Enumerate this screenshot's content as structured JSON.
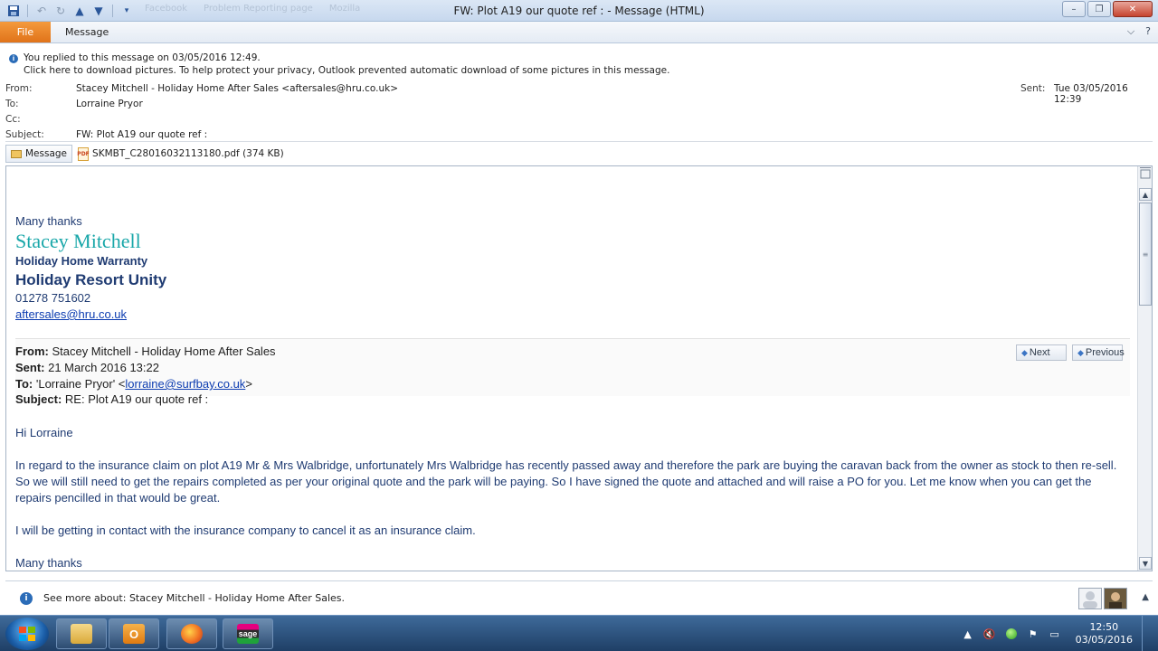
{
  "window": {
    "title": "FW: Plot A19  our quote ref :  - Message (HTML)",
    "ghost_tabs": [
      "Facebook",
      "Problem Reporting page",
      "Mozilla"
    ],
    "minimize": "–",
    "maximize": "❐",
    "close": "✕"
  },
  "ribbon": {
    "file_tab": "File",
    "message_tab": "Message",
    "expand_icon": "⌵",
    "help_icon": "?"
  },
  "infobar": {
    "line1": "You replied to this message on 03/05/2016 12:49.",
    "line2": "Click here to download pictures. To help protect your privacy, Outlook prevented automatic download of some pictures in this message."
  },
  "header": {
    "from_label": "From:",
    "from_value": "Stacey Mitchell - Holiday Home After Sales <aftersales@hru.co.uk>",
    "to_label": "To:",
    "to_value": "Lorraine Pryor",
    "cc_label": "Cc:",
    "cc_value": "",
    "subject_label": "Subject:",
    "subject_value": "FW: Plot A19  our quote ref :",
    "sent_label": "Sent:",
    "sent_value": "Tue 03/05/2016 12:39"
  },
  "attachments": {
    "message_label": "Message",
    "pdf_label": "SKMBT_C28016032113180.pdf (374 KB)"
  },
  "body": {
    "sig_thanks": "Many thanks",
    "sig_name": "Stacey Mitchell",
    "sig_warranty": "Holiday Home Warranty",
    "sig_company": "Holiday Resort Unity",
    "sig_phone": "01278 751602",
    "sig_email": "aftersales@hru.co.uk",
    "fw_from_label": "From:",
    "fw_from_value": " Stacey Mitchell - Holiday Home After Sales",
    "fw_sent_label": "Sent:",
    "fw_sent_value": " 21 March 2016 13:22",
    "fw_to_label": "To:",
    "fw_to_prefix": " 'Lorraine Pryor' <",
    "fw_to_email": "lorraine@surfbay.co.uk",
    "fw_to_suffix": ">",
    "fw_subject_label": "Subject:",
    "fw_subject_value": " RE: Plot A19 our quote ref :",
    "next_label": "Next",
    "previous_label": "Previous",
    "greeting": "Hi Lorraine",
    "para1": "In regard to the insurance claim on plot A19 Mr & Mrs Walbridge, unfortunately Mrs Walbridge has recently passed away and therefore the park are buying the caravan back from the owner as stock to then re-sell. So we will still need to get the repairs completed as per your original quote and the park will be paying. So I have signed the quote and attached and will raise a PO for you. Let me know when you can get the repairs pencilled in that would be great.",
    "para2": "I will be getting in contact with the insurance company to cancel it as an insurance claim.",
    "closing": "Many thanks"
  },
  "people_pane": {
    "text": "See more about: Stacey Mitchell - Holiday Home After Sales."
  },
  "taskbar": {
    "time": "12:50",
    "date": "03/05/2016",
    "apps": [
      "Windows Explorer",
      "Outlook",
      "Firefox",
      "Sage"
    ]
  },
  "colors": {
    "accent_blue": "#1f3b72",
    "signature_teal": "#19a7a9",
    "file_tab_orange": "#e0731a",
    "link_blue": "#0b3bb0"
  }
}
